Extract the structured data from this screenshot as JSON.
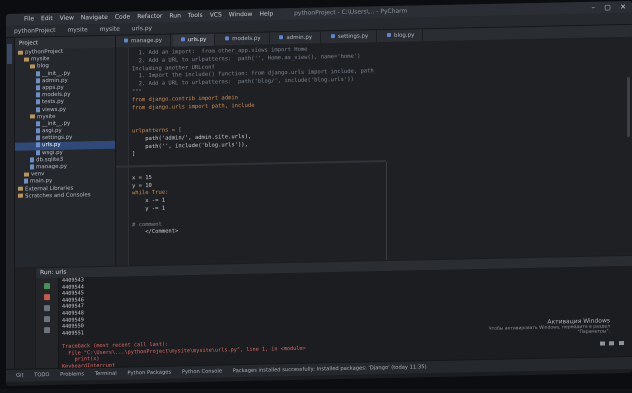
{
  "titlebar": {
    "menu": [
      "File",
      "Edit",
      "View",
      "Navigate",
      "Code",
      "Refactor",
      "Run",
      "Tools",
      "VCS",
      "Window",
      "Help"
    ],
    "title": "pythonProject - C:\\Users\\... - PyCharm"
  },
  "navbar": {
    "crumbs": [
      "pythonProject",
      "mysite",
      "mysite",
      "urls.py"
    ]
  },
  "tabs": [
    "manage.py",
    "urls.py",
    "models.py",
    "admin.py",
    "settings.py",
    "blog.py"
  ],
  "project": {
    "header": "Project",
    "items": [
      {
        "label": "pythonProject",
        "type": "folder",
        "indent": 0
      },
      {
        "label": "mysite",
        "type": "folder",
        "indent": 1
      },
      {
        "label": "blog",
        "type": "folder",
        "indent": 2
      },
      {
        "label": "__init__.py",
        "type": "file",
        "indent": 3
      },
      {
        "label": "admin.py",
        "type": "file",
        "indent": 3
      },
      {
        "label": "apps.py",
        "type": "file",
        "indent": 3
      },
      {
        "label": "models.py",
        "type": "file",
        "indent": 3
      },
      {
        "label": "tests.py",
        "type": "file",
        "indent": 3
      },
      {
        "label": "views.py",
        "type": "file",
        "indent": 3
      },
      {
        "label": "mysite",
        "type": "folder",
        "indent": 2
      },
      {
        "label": "__init__.py",
        "type": "file",
        "indent": 3
      },
      {
        "label": "asgi.py",
        "type": "file",
        "indent": 3
      },
      {
        "label": "settings.py",
        "type": "file",
        "indent": 3
      },
      {
        "label": "urls.py",
        "type": "file",
        "indent": 3
      },
      {
        "label": "wsgi.py",
        "type": "file",
        "indent": 3
      },
      {
        "label": "db.sqlite3",
        "type": "file",
        "indent": 2
      },
      {
        "label": "manage.py",
        "type": "file",
        "indent": 2
      },
      {
        "label": "venv",
        "type": "folder",
        "indent": 1
      },
      {
        "label": "main.py",
        "type": "file",
        "indent": 1
      },
      {
        "label": "External Libraries",
        "type": "folder",
        "indent": 0
      },
      {
        "label": "Scratches and Consoles",
        "type": "folder",
        "indent": 0
      }
    ]
  },
  "editor": {
    "lines": [
      "  1. Add an import:  from other_app.views import Home",
      "  2. Add a URL to urlpatterns:  path('', Home.as_view(), name='home')",
      "Including another URLconf",
      "  1. Import the include() function: from django.urls import include, path",
      "  2. Add a URL to urlpatterns:  path('blog/', include('blog.urls'))",
      "\"\"\"",
      "from django.contrib import admin",
      "from django.urls import path, include",
      "",
      "",
      "urlpatterns = [",
      "    path('admin/', admin.site.urls),",
      "    path('', include('blog.urls')),",
      "]",
      "",
      "",
      "x = 15",
      "y = 10",
      "while True:",
      "    x -= 1",
      "    y -= 1",
      "",
      "# comment",
      "    </Comment>"
    ]
  },
  "run": {
    "header": "Run:  urls",
    "lines": [
      "4409543",
      "4409544",
      "4409545",
      "4409546",
      "4409547",
      "4409548",
      "4409549",
      "4409550",
      "4409551",
      "",
      "Traceback (most recent call last):",
      "  File \"C:\\Users\\...\\pythonProject\\mysite\\mysite\\urls.py\", line 1, in <module>",
      "    print(x)",
      "KeyboardInterrupt"
    ]
  },
  "activate": {
    "title": "Активация Windows",
    "sub": "Чтобы активировать Windows, перейдите в раздел \"Параметры\"."
  },
  "statusbar": {
    "items": [
      "Git",
      "TODO",
      "Problems",
      "Terminal",
      "Python Packages",
      "Python Console"
    ],
    "message": "Packages installed successfully: Installed packages: 'Django' (today 11:35)"
  }
}
